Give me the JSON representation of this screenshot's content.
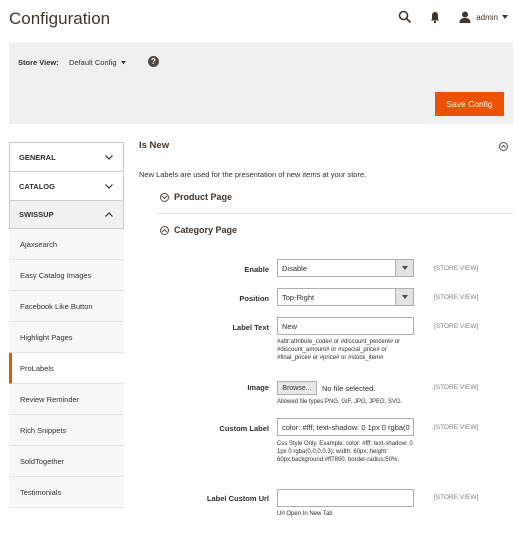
{
  "header": {
    "title": "Configuration",
    "user": "admin"
  },
  "scope": {
    "label": "Store View:",
    "value": "Default Config"
  },
  "toolbar": {
    "save_label": "Save Config"
  },
  "sidebar": {
    "sections": [
      {
        "label": "GENERAL"
      },
      {
        "label": "CATALOG"
      },
      {
        "label": "SWISSUP"
      }
    ],
    "items": [
      {
        "label": "Ajaxsearch"
      },
      {
        "label": "Easy Catalog Images"
      },
      {
        "label": "Facebook Like Button"
      },
      {
        "label": "Highlight Pages"
      },
      {
        "label": "ProLabels"
      },
      {
        "label": "Review Reminder"
      },
      {
        "label": "Rich Snippets"
      },
      {
        "label": "SoldTogether"
      },
      {
        "label": "Testimonials"
      }
    ]
  },
  "section": {
    "title": "Is New",
    "description": "New Labels are used for the presentation of new items at your store.",
    "groups": {
      "product": "Product Page",
      "category": "Category Page"
    }
  },
  "fields": {
    "enable": {
      "label": "Enable",
      "value": "Disable",
      "scope": "[STORE VIEW]"
    },
    "position": {
      "label": "Position",
      "value": "Top-Right",
      "scope": "[STORE VIEW]"
    },
    "label_text": {
      "label": "Label Text",
      "value": "New",
      "scope": "[STORE VIEW]",
      "note": "#attr:attribute_code# or #discount_percent# or #discount_amount# or #special_price# or #final_price# or #price# or #stock_item#"
    },
    "image": {
      "label": "Image",
      "browse": "Browse...",
      "file_status": "No file selected.",
      "scope": "[STORE VIEW]",
      "note": "Allowed file types:PNG, GIF, JPG, JPEG, SVG."
    },
    "custom_label": {
      "label": "Custom Label",
      "value": "color: #fff; text-shadow: 0 1px 0 rgba(0",
      "scope": "[STORE VIEW]",
      "note": "Css Style Only. Example: color: #fff; text-shadow: 0 1px 0 rgba(0,0,0,0.3); width: 60px; height: 60px;background:#ff7800; border-radius:50%;"
    },
    "label_custom_url": {
      "label": "Label Custom Url",
      "value": "",
      "scope": "[STORE VIEW]",
      "note": "Url Open In New Tab"
    }
  },
  "colors": {
    "accent": "#eb5202",
    "text": "#303030",
    "scope_bar": "#f0f0f0"
  },
  "icons": [
    "search-icon",
    "bell-icon",
    "user-icon",
    "help-icon",
    "chevron-down-icon",
    "chevron-up-icon",
    "collapse-circle-icon"
  ]
}
